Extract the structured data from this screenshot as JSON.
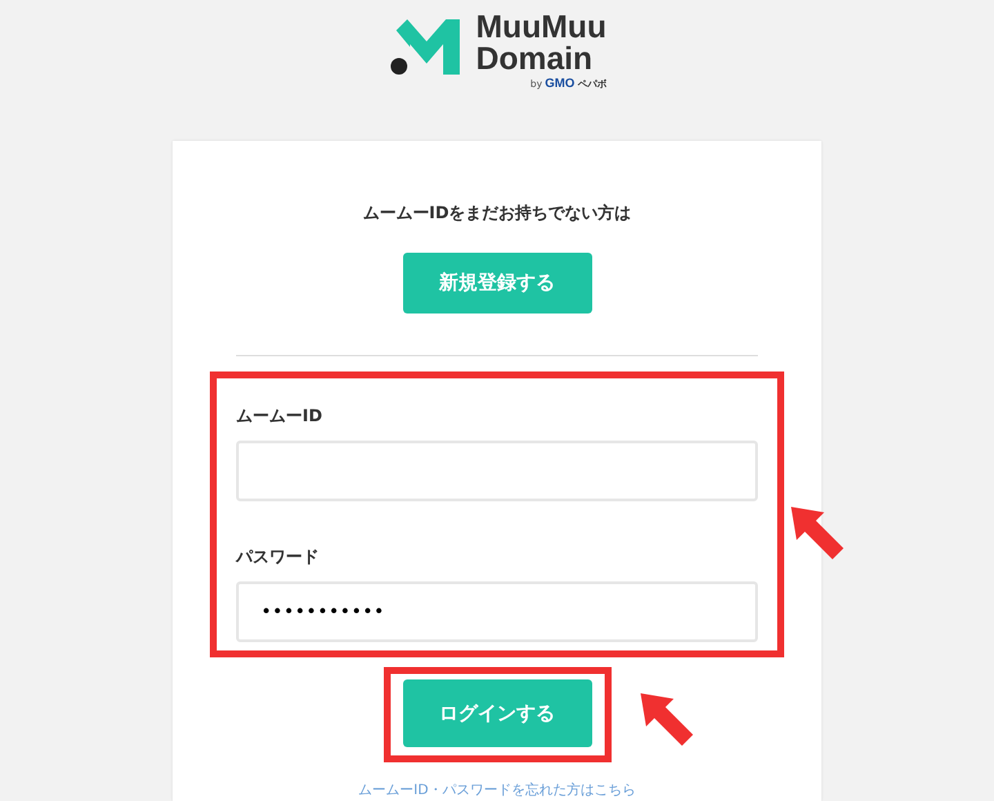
{
  "logo": {
    "line_1": "MuuMuu",
    "line_2": "Domain",
    "by": "by",
    "company": "GMO",
    "brand": "ペパボ"
  },
  "signup": {
    "prompt": "ムームーIDをまだお持ちでない方は",
    "button": "新規登録する"
  },
  "fields": [
    {
      "label": "ムームーID"
    },
    {
      "label": "パスワード",
      "value": "•••••••••••"
    }
  ],
  "login_button": "ログインする",
  "forgot_link": "ムームーID・パスワードを忘れた方はこちら"
}
